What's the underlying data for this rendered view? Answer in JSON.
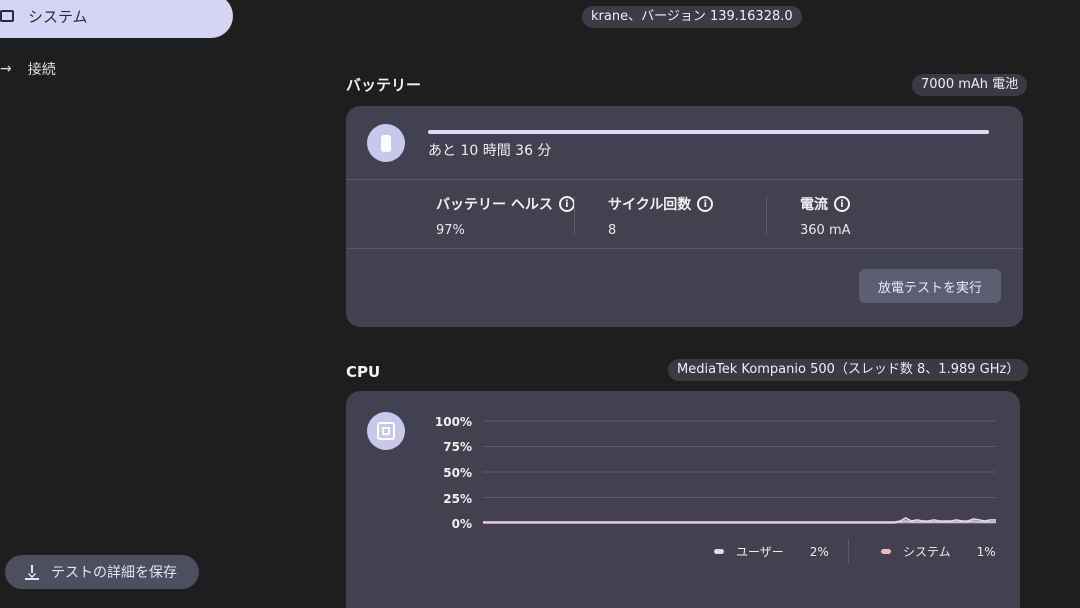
{
  "sidebar": {
    "items": [
      {
        "label": "システム",
        "icon": "laptop-icon"
      },
      {
        "label": "接続",
        "icon": "arrow-right-icon"
      }
    ],
    "save_button_label": "テストの詳細を保存",
    "save_icon": "download-icon"
  },
  "header": {
    "version": "krane、バージョン 139.16328.0"
  },
  "battery": {
    "title": "バッテリー",
    "capacity_chip": "7000 mAh 電池",
    "icon": "battery-icon",
    "charge_fraction": 1.0,
    "time_remaining": "あと 10 時間 36 分",
    "stats": [
      {
        "label": "バッテリー ヘルス",
        "value": "97%"
      },
      {
        "label": "サイクル回数",
        "value": "8"
      },
      {
        "label": "電流",
        "value": "360 mA"
      }
    ],
    "discharge_button": "放電テストを実行"
  },
  "cpu": {
    "title": "CPU",
    "model_chip": "MediaTek Kompanio 500（スレッド数 8、1.989 GHz）",
    "icon": "cpu-icon",
    "legend": [
      {
        "name": "ユーザー",
        "value": "2%",
        "color": "#dcdaf6"
      },
      {
        "name": "システム",
        "value": "1%",
        "color": "#f0b6c0"
      }
    ]
  },
  "chart_data": {
    "type": "area",
    "y_tick_labels": [
      "100%",
      "75%",
      "50%",
      "25%",
      "0%"
    ],
    "ylim": [
      0,
      100
    ],
    "grid": true,
    "legend_position": "bottom-right",
    "series": [
      {
        "name": "ユーザー",
        "color": "#dcdaf6",
        "values": [
          1,
          1,
          1,
          1,
          1,
          1,
          1,
          1,
          1,
          1,
          1,
          1,
          1,
          1,
          1,
          1,
          1,
          1,
          1,
          1,
          1,
          1,
          1,
          1,
          1,
          1,
          1,
          1,
          1,
          1,
          1,
          1,
          1,
          1,
          1,
          1,
          1,
          1,
          1,
          1,
          1,
          1,
          1,
          1,
          1,
          1,
          1,
          1,
          1,
          1,
          1,
          1,
          1,
          1,
          1,
          1,
          1,
          1,
          1,
          1,
          1,
          1,
          1,
          1,
          1,
          1,
          1,
          1,
          1,
          1,
          1,
          1,
          1,
          1,
          2,
          5,
          2,
          3,
          2,
          2,
          3,
          2,
          2,
          2,
          3,
          2,
          2,
          4,
          3,
          2,
          3,
          3
        ]
      },
      {
        "name": "システム",
        "color": "#f0b6c0",
        "values": [
          0,
          0,
          0,
          0,
          0,
          0,
          0,
          0,
          0,
          0,
          0,
          0,
          0,
          0,
          0,
          0,
          0,
          0,
          0,
          0,
          0,
          0,
          0,
          0,
          0,
          0,
          0,
          0,
          0,
          0,
          0,
          0,
          0,
          0,
          0,
          0,
          0,
          0,
          0,
          0,
          0,
          0,
          0,
          0,
          0,
          0,
          0,
          0,
          0,
          0,
          0,
          0,
          0,
          0,
          0,
          0,
          0,
          0,
          0,
          0,
          0,
          0,
          0,
          0,
          0,
          0,
          0,
          0,
          0,
          0,
          0,
          0,
          0,
          0,
          1,
          2,
          1,
          1,
          1,
          1,
          1,
          1,
          1,
          1,
          1,
          1,
          1,
          2,
          1,
          1,
          1,
          1
        ]
      }
    ]
  }
}
